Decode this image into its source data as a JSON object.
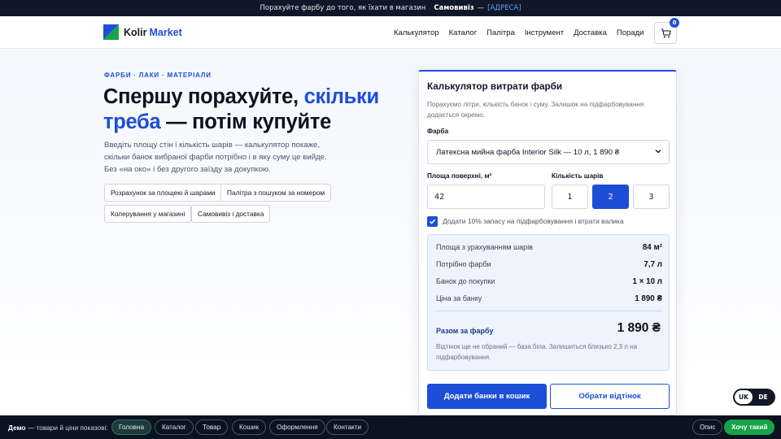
{
  "topbar": {
    "text": "Порахуйте фарбу до того, як їхати в магазин",
    "pickup": "Самовивіз",
    "dash": "—",
    "address": "[АДРЕСА]"
  },
  "header": {
    "logo_primary": "Kolir",
    "logo_secondary": "Market",
    "nav": [
      "Калькулятор",
      "Каталог",
      "Палітра",
      "Інструмент",
      "Доставка",
      "Поради"
    ],
    "cart_count": "0"
  },
  "hero": {
    "eyebrow": "ФАРБИ · ЛАКИ · МАТЕРІАЛИ",
    "title_a": "Спершу порахуйте,",
    "title_accent": "скільки треба",
    "title_b": "— потім купуйте",
    "lead": "Введіть площу стін і кількість шарів — калькулятор покаже, скільки банок вибраної фарби потрібно і в яку суму це вийде. Без «на око» і без другого заїзду за докупкою.",
    "chips": [
      "Розрахунок за площею й шарами",
      "Палітра з пошуком за номером",
      "Колерування у магазині",
      "Самовивіз і доставка"
    ]
  },
  "calc": {
    "title": "Калькулятор витрати фарби",
    "subtitle": "Порахуємо літри, кількість банок і суму. Залишок на підфарбовування додається окремо.",
    "paint_label": "Фарба",
    "paint_value": "Латексна мийна фарба Interior Silk — 10 л, 1 890 ₴",
    "area_label": "Площа поверхні, м²",
    "area_value": "42",
    "coats_label": "Кількість шарів",
    "coats": [
      "1",
      "2",
      "3"
    ],
    "coats_selected": "2",
    "reserve_label": "Додати 10% запасу на підфарбовування і втрати валика",
    "reserve_checked": true,
    "rows": [
      {
        "label": "Площа з урахуванням шарів",
        "value": "84 м²"
      },
      {
        "label": "Потрібно фарби",
        "value": "7,7 л"
      },
      {
        "label": "Банок до покупки",
        "value": "1 × 10 л"
      },
      {
        "label": "Ціна за банку",
        "value": "1 890 ₴"
      }
    ],
    "total_label": "Разом за фарбу",
    "total_value": "1 890 ₴",
    "note": "Відтінок ще не обраний — база біла. Залишиться близько 2,3 л на підфарбовування.",
    "add_button": "Додати банки в кошик",
    "tint_button": "Обрати відтінок"
  },
  "lang": {
    "active": "UK",
    "other": "DE"
  },
  "demobar": {
    "lead_bold": "Демо",
    "lead_rest": "— товари й ціни показові:",
    "pills": [
      "Головна",
      "Каталог",
      "Товар",
      "Кошик",
      "Оформлення",
      "Контакти"
    ],
    "about": "Опис",
    "cta": "Хочу такий"
  }
}
